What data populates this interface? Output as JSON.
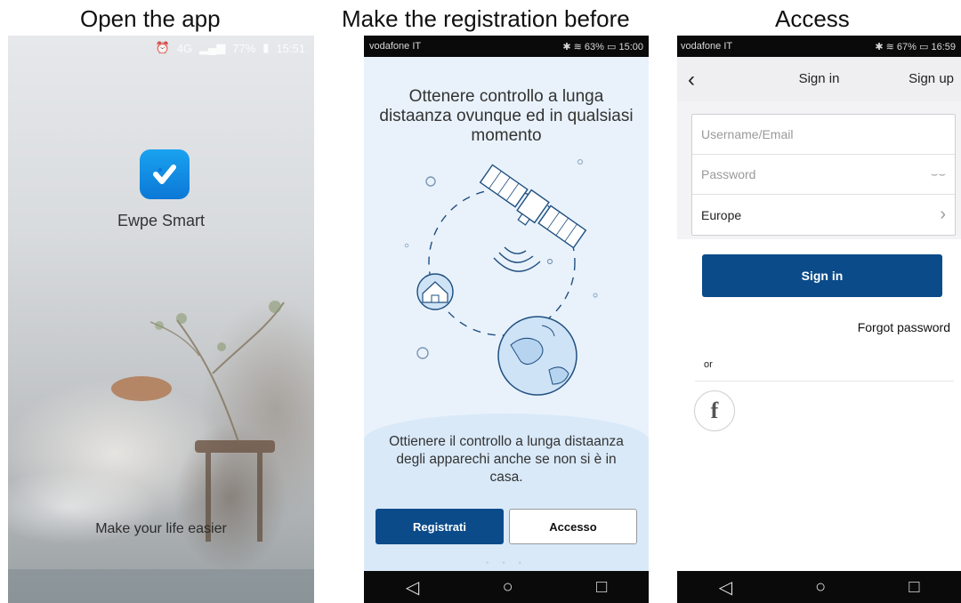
{
  "captions": {
    "open": "Open the app",
    "registration": "Make the registration before",
    "access": "Access"
  },
  "splash": {
    "status": {
      "clock_icon": "alarm-icon",
      "network": "4G",
      "battery": "77%",
      "time": "15:51"
    },
    "app_name": "Ewpe Smart",
    "tagline": "Make your life easier",
    "colors": {
      "icon_top": "#1aa2f0",
      "icon_bottom": "#0b78d6"
    }
  },
  "registration": {
    "status": {
      "carrier": "vodafone IT",
      "battery": "63%",
      "time": "15:00"
    },
    "headline": "Ottenere controllo a lunga distaanza ovunque ed in qualsiasi momento",
    "subtext": "Ottienere il controllo a lunga distaanza degli apparechi anche se non si è in casa.",
    "register_button": "Registrati",
    "access_button": "Accesso",
    "colors": {
      "primary": "#0b4b8a",
      "background": "#e9f2fb"
    }
  },
  "signin": {
    "status": {
      "carrier": "vodafone IT",
      "battery": "67%",
      "time": "16:59"
    },
    "title": "Sign in",
    "signup_link": "Sign up",
    "username_placeholder": "Username/Email",
    "password_placeholder": "Password",
    "region": "Europe",
    "signin_button": "Sign in",
    "forgot_password": "Forgot password",
    "or_label": "or",
    "facebook_glyph": "f",
    "colors": {
      "primary": "#0b4b8a",
      "header_bg": "#efeff1"
    }
  },
  "nav": {
    "back": "◁",
    "home": "○",
    "recent": "□"
  }
}
